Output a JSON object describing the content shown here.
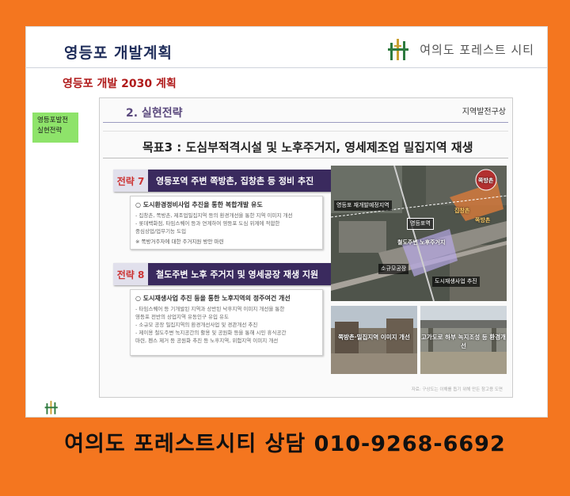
{
  "slide": {
    "title": "영등포 개발계획",
    "brand_name": "여의도 포레스트 시티",
    "subtitle": "영등포 개발 2030 계획",
    "side_tag": [
      "영등포발전",
      "실현전략"
    ]
  },
  "panel": {
    "heading": "2. 실현전략",
    "tag": "지역발전구상",
    "goal": "목표3 : 도심부적격시설 및 노후주거지, 영세제조업 밀집지역 재생",
    "strategies": [
      {
        "num": "전략 7",
        "text": "영등포역 주변 쪽방촌, 집창촌 등 정비 추진",
        "head": "○ 도시환경정비사업 추진을 통한 복합개발 유도",
        "lines": [
          "- 집창촌, 쪽방촌, 제조업밀집지역 등의 환경개선을 통한 지역 이미지 개선",
          "- 롯데백화점, 타임스퀘어 등과 연계하여 영등포 도심 위계에 적합한",
          "  중심상업/업무기능 도입"
        ],
        "note": "※ 쪽방거주자에 대한 주거지원 방안 마련"
      },
      {
        "num": "전략 8",
        "text": "철도주변 노후 주거지 및 영세공장 재생 지원",
        "head": "○ 도시재생사업 추진 등을 통한 노후지역의 정주여건 개선",
        "lines": [
          "- 타임스퀘어 등 기개발된 지역과 상반된 낙후지역 이미지 개선을 통한",
          "  영등포 전반의 상업지역 유동인구 유입 유도",
          "- 소규모 공장 밀집지역의 환경개선사업 및 경관개선 추진",
          "- 제이용 철도주변 녹지공간의 활용 및 공원화 등을 통해 시민 휴식공간",
          "  마련, 펜스 제거 등 공원화 추진 등 노후지역, 위험지역 이미지 개선"
        ],
        "note": ""
      }
    ],
    "map_labels": {
      "circle": "쪽방촌",
      "district": "영등포 재개발예정지역",
      "area1": "집창촌",
      "area2": "쪽방촌",
      "station": "영등포역",
      "rail": "철도주변 노후주거지",
      "factory": "소규모공장",
      "footnote": "도시재생사업 추진"
    },
    "photo_captions": [
      "쪽방촌·밀집지역 이미지 개선",
      "고가도로 하부 녹지조성 등 환경개선"
    ],
    "source": "자료: 구상도는 이해를 돕기 위해 만든 참고용 도면"
  },
  "contact": "여의도 포레스트시티 상담 010-9268-6692",
  "colors": {
    "frame": "#f4761f",
    "title": "#1f2d5a",
    "subtitle": "#b01a1a",
    "strategy_bg": "#3a2a5e",
    "side_tag": "#8ee36a"
  },
  "icons": [
    "brand-logo-icon",
    "footer-logo-icon"
  ]
}
